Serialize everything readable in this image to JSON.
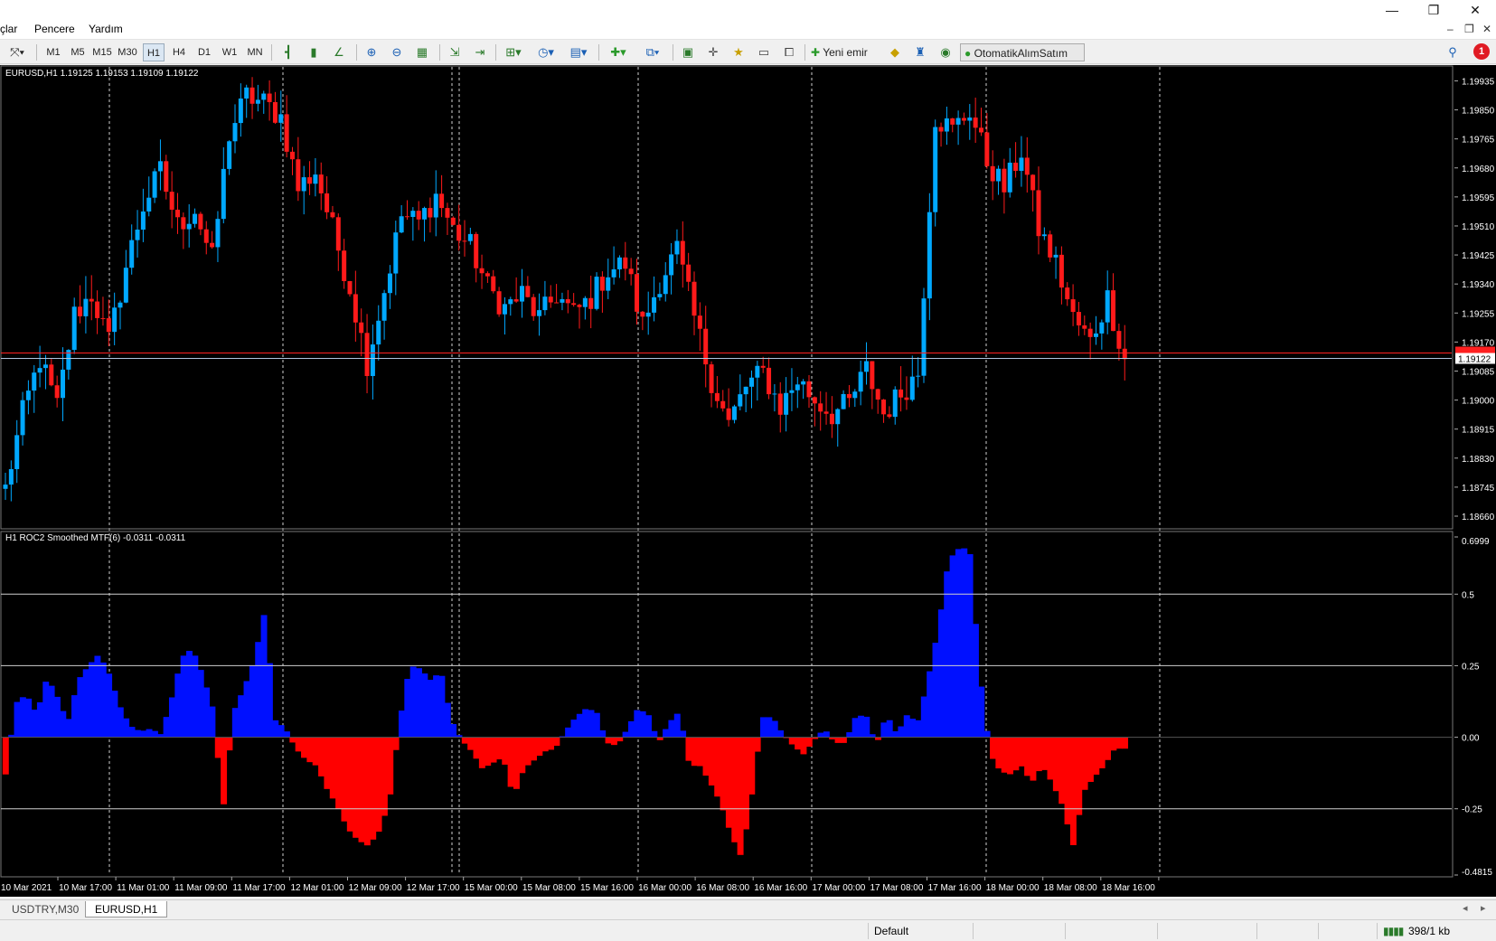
{
  "menu": {
    "items": [
      "çlar",
      "Pencere",
      "Yardım"
    ]
  },
  "window_controls": {
    "minimize": "—",
    "restore": "❐",
    "close": "✕"
  },
  "toolbar": {
    "timeframes": [
      "M1",
      "M5",
      "M15",
      "M30",
      "H1",
      "H4",
      "D1",
      "W1",
      "MN"
    ],
    "active_timeframe": "H1",
    "new_order": "Yeni emir",
    "autotrading": "OtomatikAlımSatım",
    "notification_count": "1"
  },
  "chart": {
    "header": "EURUSD,H1  1.19125 1.19153 1.19109 1.19122",
    "current_price_label": "1.19122",
    "price_ticks": [
      "1.19935",
      "1.19850",
      "1.19765",
      "1.19680",
      "1.19595",
      "1.19510",
      "1.19425",
      "1.19340",
      "1.19255",
      "1.19170",
      "1.19085",
      "1.19000",
      "1.18915",
      "1.18830",
      "1.18745",
      "1.18660"
    ],
    "time_labels": [
      "10 Mar 2021",
      "10 Mar 17:00",
      "11 Mar 01:00",
      "11 Mar 09:00",
      "11 Mar 17:00",
      "12 Mar 01:00",
      "12 Mar 09:00",
      "12 Mar 17:00",
      "15 Mar 00:00",
      "15 Mar 08:00",
      "15 Mar 16:00",
      "16 Mar 00:00",
      "16 Mar 08:00",
      "16 Mar 16:00",
      "17 Mar 00:00",
      "17 Mar 08:00",
      "17 Mar 16:00",
      "18 Mar 00:00",
      "18 Mar 08:00",
      "18 Mar 16:00"
    ]
  },
  "indicator": {
    "header": "H1 ROC2 Smoothed MTF(6) -0.0311 -0.0311",
    "ticks": [
      "0.6999",
      "0.5",
      "0.25",
      "0.00",
      "-0.25",
      "-0.4815"
    ]
  },
  "tabs": [
    "USDTRY,M30",
    "EURUSD,H1"
  ],
  "active_tab": "EURUSD,H1",
  "status": {
    "profile": "Default",
    "traffic": "398/1 kb"
  },
  "chart_data": {
    "type": "candlestick",
    "symbol": "EURUSD",
    "timeframe": "H1",
    "ylim": [
      1.1866,
      1.1996
    ],
    "seed_open": 1.1874,
    "close_path": [
      1.1874,
      1.1896,
      1.1912,
      1.1898,
      1.1925,
      1.1931,
      1.1917,
      1.1939,
      1.1957,
      1.1967,
      1.1951,
      1.1956,
      1.1941,
      1.1978,
      1.1989,
      1.1987,
      1.1983,
      1.1962,
      1.1967,
      1.195,
      1.1933,
      1.1911,
      1.1932,
      1.1954,
      1.1952,
      1.196,
      1.195,
      1.1945,
      1.1933,
      1.1927,
      1.1931,
      1.1924,
      1.1931,
      1.1925,
      1.193,
      1.1938,
      1.194,
      1.1922,
      1.1935,
      1.1944,
      1.1924,
      1.1906,
      1.1893,
      1.1904,
      1.1908,
      1.1898,
      1.1906,
      1.19,
      1.1896,
      1.1899,
      1.1909,
      1.1896,
      1.1902,
      1.1908,
      1.1983,
      1.1979,
      1.1985,
      1.197,
      1.1962,
      1.1973,
      1.195,
      1.194,
      1.1924,
      1.1917,
      1.193,
      1.1912
    ],
    "candles_per_step": 3,
    "trend_noise": 0.0008,
    "oscillator": {
      "name": "ROC2 Smoothed MTF(6)",
      "ylim": [
        -0.4815,
        0.6999
      ],
      "levels": [
        0.5,
        0.25,
        0,
        -0.25
      ],
      "value_path": [
        -0.13,
        0.12,
        0.15,
        0.08,
        0.21,
        0.14,
        0.05,
        0.2,
        0.25,
        0.29,
        0.22,
        0.11,
        0.04,
        0.02,
        0.03,
        0.01,
        0.13,
        0.28,
        0.31,
        0.22,
        0.1,
        -0.25,
        0.09,
        0.17,
        0.27,
        0.44,
        0.06,
        0.03,
        -0.04,
        -0.08,
        -0.1,
        -0.18,
        -0.24,
        -0.32,
        -0.36,
        -0.38,
        -0.33,
        -0.23,
        0.05,
        0.25,
        0.24,
        0.2,
        0.23,
        0.06,
        -0.01,
        -0.05,
        -0.11,
        -0.09,
        -0.07,
        -0.21,
        -0.11,
        -0.08,
        -0.05,
        -0.04,
        0.02,
        0.07,
        0.1,
        0.09,
        -0.02,
        -0.03,
        0.03,
        0.1,
        0.08,
        -0.02,
        0.05,
        0.09,
        -0.1,
        -0.1,
        -0.16,
        -0.23,
        -0.34,
        -0.42,
        -0.2,
        0.07,
        0.07,
        0.01,
        -0.03,
        -0.06,
        -0.01,
        0.03,
        -0.02,
        -0.02,
        0.07,
        0.08,
        -0.03,
        0.08,
        0.01,
        0.08,
        0.05,
        0.2,
        0.38,
        0.62,
        0.66,
        0.66,
        0.22,
        -0.06,
        -0.12,
        -0.13,
        -0.1,
        -0.16,
        -0.1,
        -0.16,
        -0.24,
        -0.38,
        -0.19,
        -0.14,
        -0.1,
        -0.04,
        -0.04
      ]
    }
  }
}
